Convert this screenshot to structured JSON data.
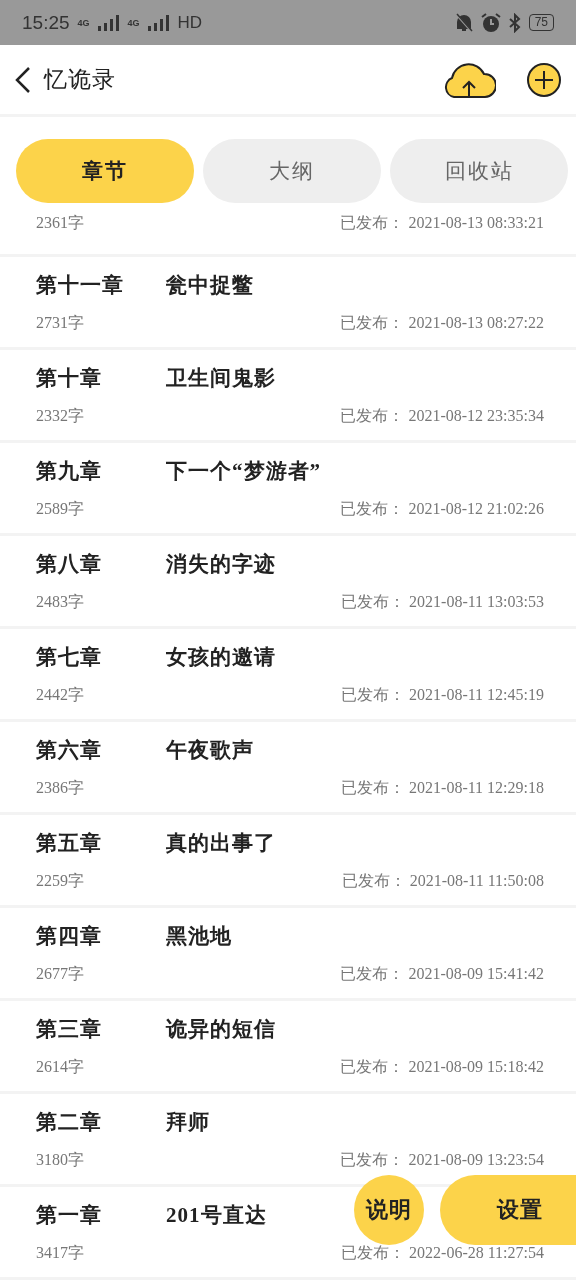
{
  "status_bar": {
    "time": "15:25",
    "network_1": "4G",
    "network_2": "4G",
    "hd": "HD",
    "battery": "75"
  },
  "header": {
    "title": "忆诡录"
  },
  "tabs": [
    {
      "label": "章节",
      "selected": true
    },
    {
      "label": "大纲",
      "selected": false
    },
    {
      "label": "回收站",
      "selected": false
    }
  ],
  "partial_row": {
    "words": "2361字",
    "published": "已发布： 2021-08-13 08:33:21"
  },
  "chapters": [
    {
      "number": "第十一章",
      "title": "瓮中捉鳖",
      "words": "2731字",
      "published": "已发布： 2021-08-13 08:27:22"
    },
    {
      "number": "第十章",
      "title": "卫生间鬼影",
      "words": "2332字",
      "published": "已发布： 2021-08-12 23:35:34"
    },
    {
      "number": "第九章",
      "title": "下一个“梦游者”",
      "words": "2589字",
      "published": "已发布： 2021-08-12 21:02:26"
    },
    {
      "number": "第八章",
      "title": "消失的字迹",
      "words": "2483字",
      "published": "已发布： 2021-08-11 13:03:53"
    },
    {
      "number": "第七章",
      "title": "女孩的邀请",
      "words": "2442字",
      "published": "已发布： 2021-08-11 12:45:19"
    },
    {
      "number": "第六章",
      "title": "午夜歌声",
      "words": "2386字",
      "published": "已发布： 2021-08-11 12:29:18"
    },
    {
      "number": "第五章",
      "title": "真的出事了",
      "words": "2259字",
      "published": "已发布： 2021-08-11 11:50:08"
    },
    {
      "number": "第四章",
      "title": "黑池地",
      "words": "2677字",
      "published": "已发布： 2021-08-09 15:41:42"
    },
    {
      "number": "第三章",
      "title": "诡异的短信",
      "words": "2614字",
      "published": "已发布： 2021-08-09 15:18:42"
    },
    {
      "number": "第二章",
      "title": "拜师",
      "words": "3180字",
      "published": "已发布： 2021-08-09 13:23:54"
    },
    {
      "number": "第一章",
      "title": "201号直达",
      "words": "3417字",
      "published": "已发布： 2022-06-28 11:27:54"
    }
  ],
  "floating_buttons": {
    "help": "说明",
    "settings": "设置"
  }
}
